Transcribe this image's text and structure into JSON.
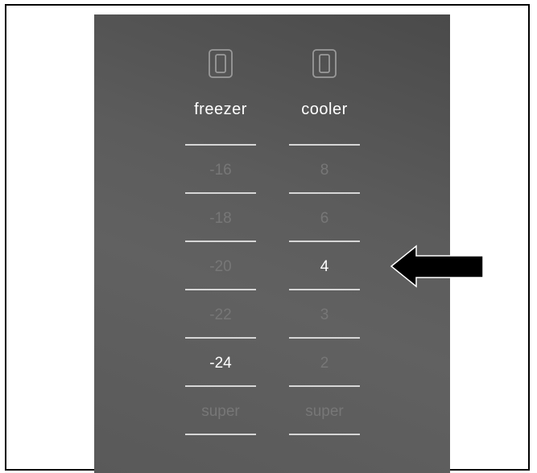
{
  "columns": [
    {
      "id": "freezer",
      "title": "freezer",
      "icon": "door-icon",
      "settings": [
        {
          "label": "-16",
          "active": false
        },
        {
          "label": "-18",
          "active": false
        },
        {
          "label": "-20",
          "active": false
        },
        {
          "label": "-22",
          "active": false
        },
        {
          "label": "-24",
          "active": true
        },
        {
          "label": "super",
          "active": false
        }
      ]
    },
    {
      "id": "cooler",
      "title": "cooler",
      "icon": "door-icon",
      "settings": [
        {
          "label": "8",
          "active": false
        },
        {
          "label": "6",
          "active": false
        },
        {
          "label": "4",
          "active": true
        },
        {
          "label": "3",
          "active": false
        },
        {
          "label": "2",
          "active": false
        },
        {
          "label": "super",
          "active": false
        }
      ]
    }
  ],
  "colors": {
    "panel": "#5a5a5a",
    "active_text": "#ffffff",
    "inactive_text": "#777777",
    "divider": "#d6d6d6",
    "arrow_fill": "#000000"
  },
  "pointer_icon": "left-arrow-icon"
}
